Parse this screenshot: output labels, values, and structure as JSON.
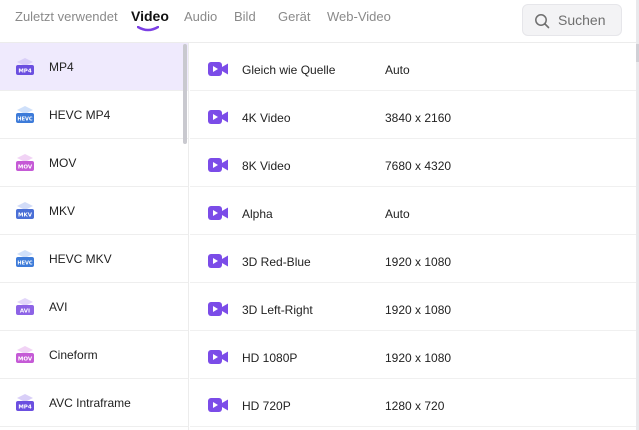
{
  "tabs": [
    {
      "label": "Zuletzt verwendet",
      "active": false
    },
    {
      "label": "Video",
      "active": true
    },
    {
      "label": "Audio",
      "active": false
    },
    {
      "label": "Bild",
      "active": false
    },
    {
      "label": "Gerät",
      "active": false
    },
    {
      "label": "Web-Video",
      "active": false
    }
  ],
  "search": {
    "placeholder": "Suchen",
    "icon": "search-icon"
  },
  "formats": [
    {
      "label": "MP4",
      "badge": "MP4",
      "badge_color": "#6b4fe0",
      "selected": true
    },
    {
      "label": "HEVC MP4",
      "badge": "HEVC",
      "badge_color": "#3d7bd9",
      "selected": false
    },
    {
      "label": "MOV",
      "badge": "MOV",
      "badge_color": "#c55ad6",
      "selected": false
    },
    {
      "label": "MKV",
      "badge": "MKV",
      "badge_color": "#4a6fd6",
      "selected": false
    },
    {
      "label": "HEVC MKV",
      "badge": "HEVC",
      "badge_color": "#3d7bd9",
      "selected": false
    },
    {
      "label": "AVI",
      "badge": "AVI",
      "badge_color": "#8d63e6",
      "selected": false
    },
    {
      "label": "Cineform",
      "badge": "MOV",
      "badge_color": "#c55ad6",
      "selected": false
    },
    {
      "label": "AVC Intraframe",
      "badge": "MP4",
      "badge_color": "#6b4fe0",
      "selected": false
    }
  ],
  "presets": [
    {
      "name": "Gleich wie Quelle",
      "resolution": "Auto"
    },
    {
      "name": "4K Video",
      "resolution": "3840 x 2160"
    },
    {
      "name": "8K Video",
      "resolution": "7680 x 4320"
    },
    {
      "name": "Alpha",
      "resolution": "Auto"
    },
    {
      "name": "3D Red-Blue",
      "resolution": "1920 x 1080"
    },
    {
      "name": "3D Left-Right",
      "resolution": "1920 x 1080"
    },
    {
      "name": "HD 1080P",
      "resolution": "1920 x 1080"
    },
    {
      "name": "HD 720P",
      "resolution": "1280 x 720"
    }
  ],
  "colors": {
    "accent": "#7b3fe4",
    "selected_bg": "#efeafd",
    "video_icon": "#7b4ce8"
  }
}
